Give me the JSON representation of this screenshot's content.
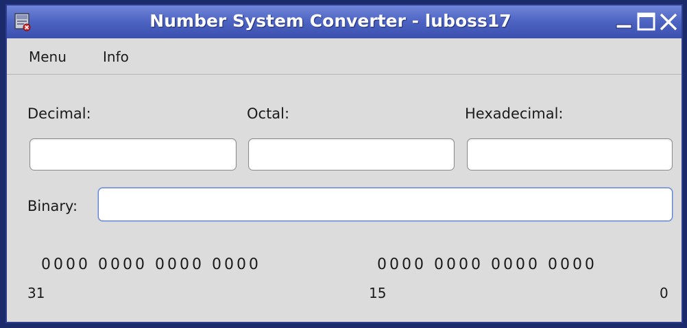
{
  "window": {
    "title": "Number System Converter - luboss17",
    "icon": "app-icon",
    "buttons": [
      "minimize-icon",
      "maximize-icon",
      "close-icon"
    ]
  },
  "menu": {
    "items": [
      {
        "label": "Menu"
      },
      {
        "label": "Info"
      }
    ]
  },
  "fields": {
    "decimal": {
      "label": "Decimal:",
      "value": ""
    },
    "octal": {
      "label": "Octal:",
      "value": ""
    },
    "hexadecimal": {
      "label": "Hexadecimal:",
      "value": ""
    },
    "binary": {
      "label": "Binary:",
      "value": ""
    }
  },
  "bits": {
    "high_word": "0000 0000 0000 0000",
    "low_word": "0000 0000 0000 0000",
    "markers": {
      "bit31": "31",
      "bit15": "15",
      "bit0": "0"
    }
  },
  "colors": {
    "titlebar": "#4d63c2",
    "background": "#dcdcdc",
    "focus_border": "#5b7bc7"
  }
}
